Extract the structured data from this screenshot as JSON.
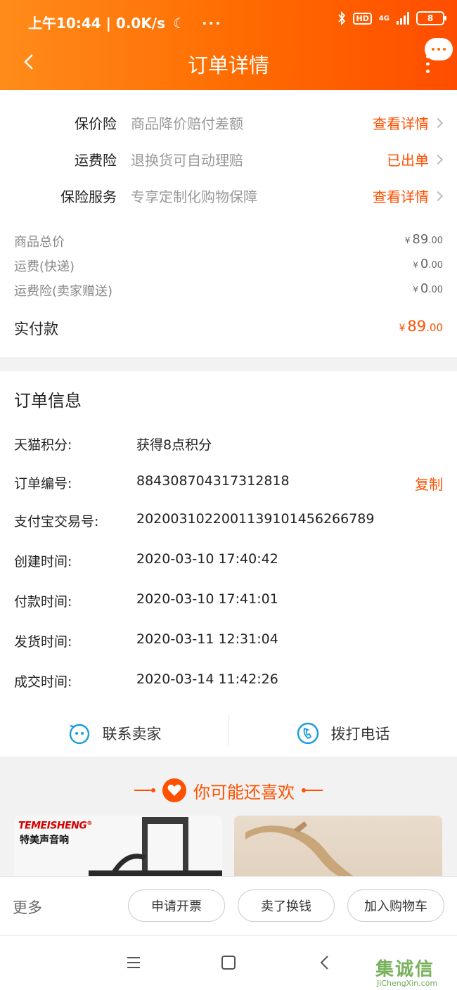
{
  "status_bar": {
    "time": "上午10:44",
    "net_speed": "0.0K/s",
    "hd": "HD",
    "net_type": "4G",
    "battery": "8"
  },
  "nav": {
    "title": "订单详情"
  },
  "insurance": [
    {
      "label": "保价险",
      "desc": "商品降价赔付差额",
      "link": "查看详情"
    },
    {
      "label": "运费险",
      "desc": "退换货可自动理赔",
      "link": "已出单"
    },
    {
      "label": "保险服务",
      "desc": "专享定制化购物保障",
      "link": "查看详情"
    }
  ],
  "prices": {
    "currency": "¥",
    "rows": [
      {
        "label": "商品总价",
        "int": "89",
        "dec": ".00"
      },
      {
        "label": "运费(快递)",
        "int": "0",
        "dec": ".00"
      },
      {
        "label": "运费险(卖家赠送)",
        "int": "0",
        "dec": ".00"
      }
    ],
    "total_label": "实付款",
    "total_int": "89",
    "total_dec": ".00"
  },
  "order_info": {
    "title": "订单信息",
    "copy_label": "复制",
    "rows": [
      {
        "key": "天猫积分:",
        "value": "获得8点积分"
      },
      {
        "key": "订单编号:",
        "value": "884308704317312818"
      },
      {
        "key": "支付宝交易号:",
        "value": "2020031022001139101456266789"
      },
      {
        "key": "创建时间:",
        "value": "2020-03-10 17:40:42"
      },
      {
        "key": "付款时间:",
        "value": "2020-03-10 17:41:01"
      },
      {
        "key": "发货时间:",
        "value": "2020-03-11 12:31:04"
      },
      {
        "key": "成交时间:",
        "value": "2020-03-14 11:42:26"
      }
    ],
    "contact_seller": "联系卖家",
    "call_phone": "拨打电话"
  },
  "recommend": {
    "title": "你可能还喜欢",
    "brand": "TEMEISHENG",
    "brand_mark": "®",
    "brand_sub": "特美声音响"
  },
  "actions": {
    "more": "更多",
    "invoice": "申请开票",
    "sell": "卖了换钱",
    "add_cart": "加入购物车"
  },
  "watermark": {
    "chars": "集诚信",
    "url": "JiChengXin.com"
  },
  "colors": {
    "accent": "#ff5000",
    "header_start": "#ff8c1a",
    "header_end": "#ff4d00"
  }
}
